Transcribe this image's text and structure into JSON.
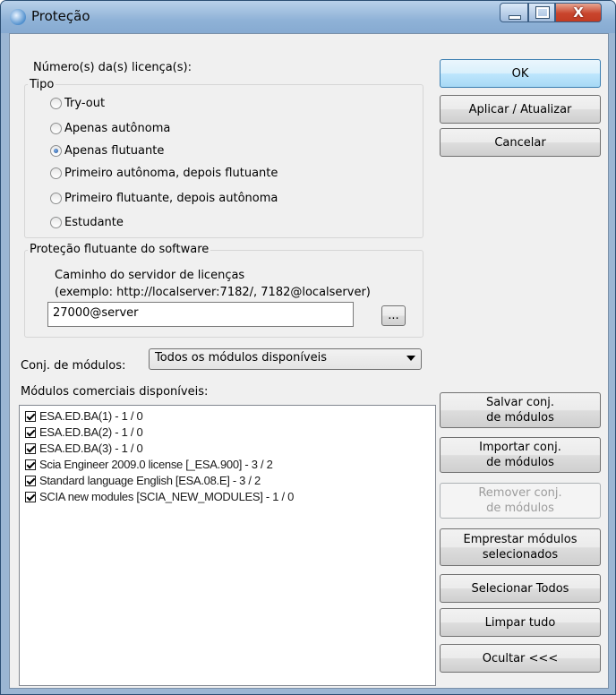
{
  "window": {
    "title": "Proteção"
  },
  "license_numbers_label": "Número(s) da(s) licença(s):",
  "tipo": {
    "legend": "Tipo",
    "options": [
      {
        "label": "Try-out",
        "checked": false
      },
      {
        "label": "Apenas autônoma",
        "checked": false
      },
      {
        "label": "Apenas flutuante",
        "checked": true
      },
      {
        "label": "Primeiro autônoma, depois flutuante",
        "checked": false
      },
      {
        "label": "Primeiro flutuante, depois autônoma",
        "checked": false
      },
      {
        "label": "Estudante",
        "checked": false
      }
    ]
  },
  "floating": {
    "legend": "Proteção flutuante do software",
    "server_path_label": "Caminho do servidor de licenças",
    "server_example": "(exemplo: http://localserver:7182/, 7182@localserver)",
    "server_value": "27000@server",
    "browse_label": "..."
  },
  "module_set": {
    "label": "Conj. de módulos:",
    "selected": "Todos os módulos disponíveis"
  },
  "modules": {
    "label": "Módulos comerciais disponíveis:",
    "items": [
      "ESA.ED.BA(1) - 1 / 0",
      "ESA.ED.BA(2) - 1 / 0",
      "ESA.ED.BA(3) - 1 / 0",
      "Scia Engineer 2009.0 license [_ESA.900] - 3 / 2",
      "Standard language English [ESA.08.E] - 3 / 2",
      "SCIA new modules [SCIA_NEW_MODULES] - 1 / 0"
    ]
  },
  "buttons": {
    "ok": "OK",
    "apply": "Aplicar / Atualizar",
    "cancel": "Cancelar",
    "save_set_1": "Salvar conj.",
    "save_set_2": "de módulos",
    "import_set_1": "Importar conj.",
    "import_set_2": "de módulos",
    "remove_set_1": "Remover conj.",
    "remove_set_2": "de módulos",
    "borrow_1": "Emprestar módulos",
    "borrow_2": "selecionados",
    "select_all": "Selecionar Todos",
    "clear_all": "Limpar tudo",
    "hide": "Ocultar <<<"
  }
}
